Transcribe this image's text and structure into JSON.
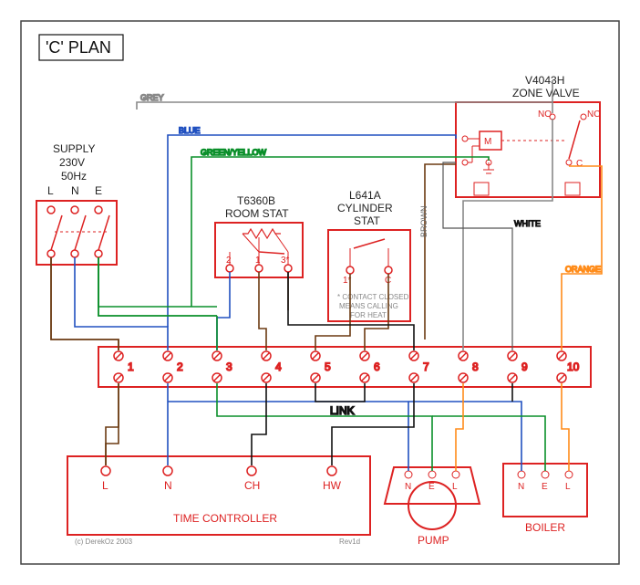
{
  "title": "'C' PLAN",
  "supply": {
    "label": "SUPPLY",
    "voltage": "230V",
    "freq": "50Hz",
    "pins": [
      "L",
      "N",
      "E"
    ]
  },
  "room_stat": {
    "title1": "T6360B",
    "title2": "ROOM STAT",
    "pins": [
      "2",
      "1",
      "3*"
    ]
  },
  "cylinder_stat": {
    "title1": "L641A",
    "title2": "CYLINDER",
    "title3": "STAT",
    "pins": [
      "1*",
      "C"
    ],
    "note1": "* CONTACT CLOSED",
    "note2": "MEANS CALLING",
    "note3": "FOR HEAT"
  },
  "zone_valve": {
    "title1": "V4043H",
    "title2": "ZONE VALVE",
    "m": "M",
    "no": "NO",
    "nc": "NC",
    "c": "C"
  },
  "terminals": {
    "labels": [
      "1",
      "2",
      "3",
      "4",
      "5",
      "6",
      "7",
      "8",
      "9",
      "10"
    ],
    "link": "LINK"
  },
  "time_controller": {
    "title": "TIME CONTROLLER",
    "pins": [
      "L",
      "N",
      "CH",
      "HW"
    ]
  },
  "pump": {
    "title": "PUMP",
    "pins": [
      "N",
      "E",
      "L"
    ]
  },
  "boiler": {
    "title": "BOILER",
    "pins": [
      "N",
      "E",
      "L"
    ]
  },
  "wires": {
    "grey": "GREY",
    "blue": "BLUE",
    "gy": "GREEN/YELLOW",
    "brown": "BROWN",
    "white": "WHITE",
    "orange": "ORANGE"
  },
  "footer": {
    "copyright": "(c) DerekOz 2003",
    "rev": "Rev1d"
  },
  "colors": {
    "red": "#d22",
    "blue": "#2050c0",
    "green": "#0a8f2a",
    "brown": "#6b3a12",
    "grey": "#888",
    "orange": "#ff8c1a",
    "black": "#111"
  }
}
